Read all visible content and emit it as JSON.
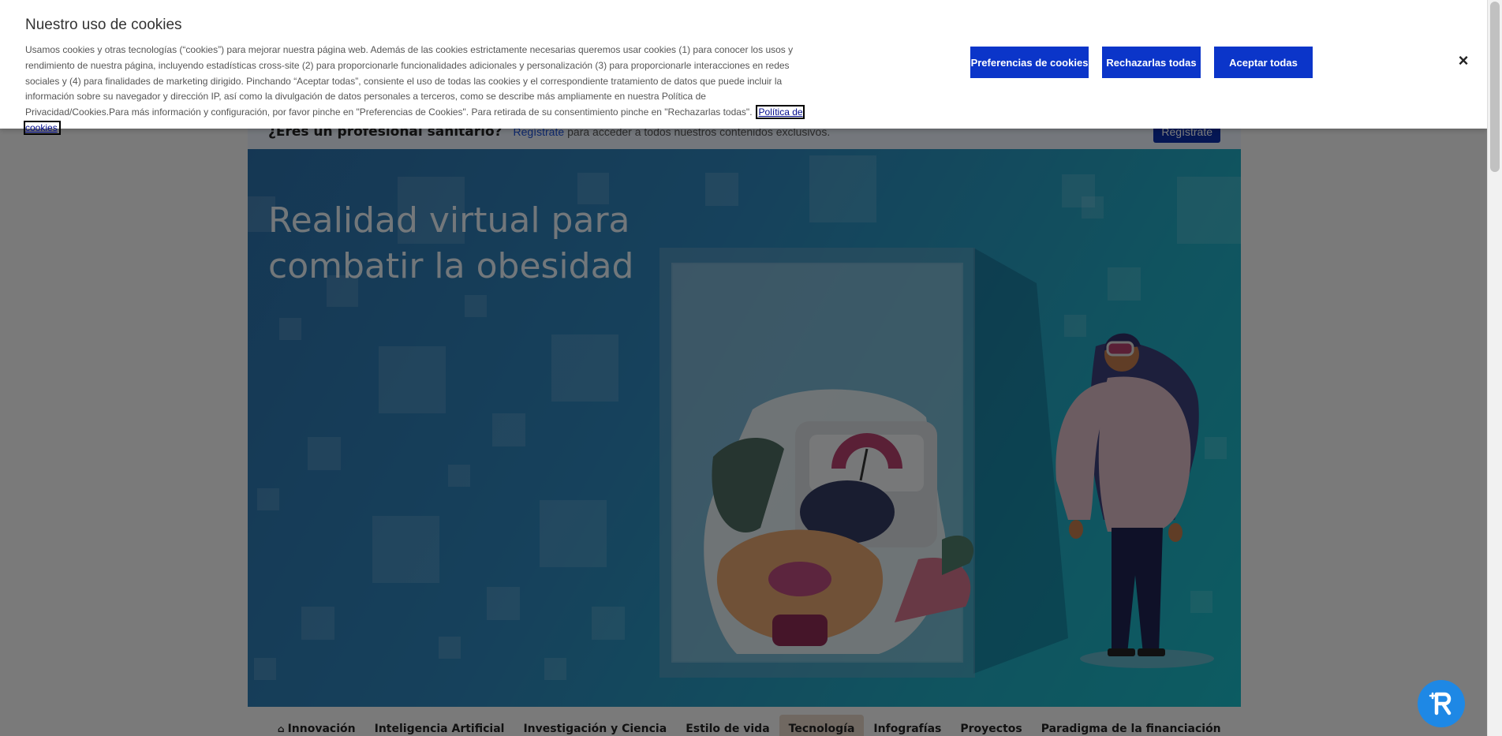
{
  "cookie_banner": {
    "title": "Nuestro uso de cookies",
    "text": "Usamos cookies y otras tecnologías (“cookies”) para mejorar nuestra página web. Además de las cookies estrictamente necesarias queremos usar cookies (1) para conocer los usos y rendimiento de nuestra página, incluyendo estadísticas cross-site (2) para proporcionarle funcionalidades adicionales y personalización (3) para proporcionarle interacciones en redes sociales y (4) para finalidades de marketing dirigido. Pinchando “Aceptar todas”, consiente el uso de todas las cookies y el correspondiente tratamiento de datos que puede incluir la información sobre su navegador y dirección IP, así como la divulgación de datos personales a terceros, como se describe más ampliamente en nuestra Política de Privacidad/Cookies.Para más información y configuración, por favor pinche en \"Preferencias de Cookies\". Para retirada de su consentimiento pinche en \"Rechazarlas todas\".",
    "policy_link": "Política de cookies",
    "btn_preferences": "Preferencias de cookies",
    "btn_reject": "Rechazarlas todas",
    "btn_accept": "Aceptar todas",
    "close_icon": "×"
  },
  "register_bar": {
    "question": "¿Eres un profesional sanitario?",
    "link": "Regístrate",
    "text": "para acceder a todos nuestros contenidos exclusivos.",
    "button": "Regístrate"
  },
  "hero": {
    "title": "Realidad virtual para combatir la obesidad"
  },
  "categories": [
    {
      "label": "Innovación",
      "icon": "home-icon"
    },
    {
      "label": "Inteligencia Artificial"
    },
    {
      "label": "Investigación y Ciencia"
    },
    {
      "label": "Estilo de vida"
    },
    {
      "label": "Tecnología",
      "active": true
    },
    {
      "label": "Infografías"
    },
    {
      "label": "Proyectos"
    },
    {
      "label": "Paradigma de la financiación"
    }
  ],
  "colors": {
    "button_blue": "#0b35c9",
    "overlay": "rgba(0,0,0,0.5)",
    "hero_from": "#2b6fa8",
    "hero_to": "#19b8c4",
    "fab": "#1e88e5"
  }
}
